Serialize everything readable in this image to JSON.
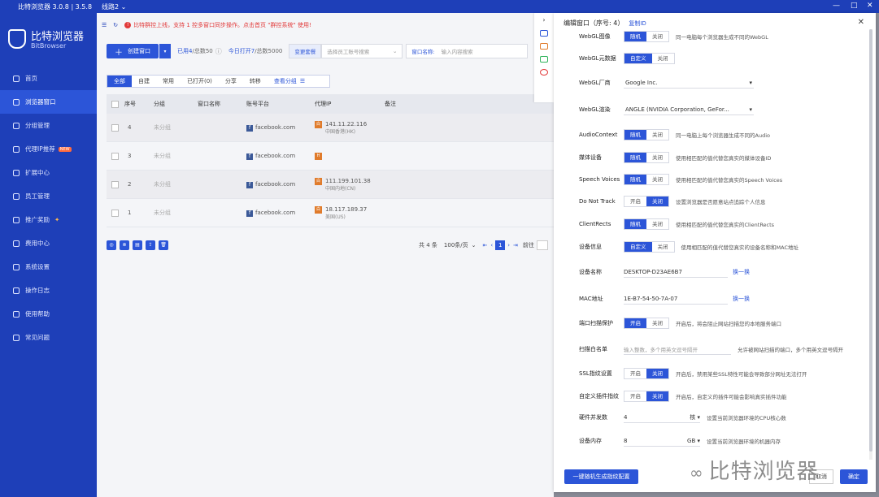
{
  "titlebar": {
    "title": "比特浏览器 3.0.8 | 3.5.8",
    "route": "线路2 ⌄"
  },
  "logo": {
    "name": "比特浏览器",
    "sub": "BitBrowser"
  },
  "sidebar": {
    "items": [
      {
        "label": "首页"
      },
      {
        "label": "浏览器窗口"
      },
      {
        "label": "分组管理"
      },
      {
        "label": "代理IP推荐",
        "badge": "NEW"
      },
      {
        "label": "扩展中心"
      },
      {
        "label": "员工管理"
      },
      {
        "label": "推广奖励"
      },
      {
        "label": "费用中心"
      },
      {
        "label": "系统设置"
      },
      {
        "label": "操作日志"
      },
      {
        "label": "使用帮助"
      },
      {
        "label": "常见问题"
      }
    ]
  },
  "notice": {
    "text": "比特群控上线，支持 1 控多窗口同步操作。点击首页 \"群控系统\" 使用!"
  },
  "toolbar": {
    "create": "创建窗口",
    "opened": "已用4",
    "total": "/总数50",
    "today": "今日打开7",
    "today_total": "/总数5000",
    "change_pkg": "变更套餐",
    "employee_placeholder": "选择员工账号搜索",
    "name_label": "窗口名称:",
    "name_placeholder": "输入内容搜索"
  },
  "tabs": {
    "items": [
      "全部",
      "自建",
      "常用",
      "已打开(0)",
      "分享",
      "转移"
    ],
    "group": "查看分组"
  },
  "table": {
    "headers": [
      "序号",
      "分组",
      "窗口名称",
      "账号平台",
      "代理IP",
      "备注"
    ],
    "rows": [
      {
        "idx": "4",
        "group": "未分组",
        "platform": "facebook.com",
        "ip": "141.11.22.116",
        "loc": "中国香港(HK)",
        "flag": "白"
      },
      {
        "idx": "3",
        "group": "未分组",
        "platform": "facebook.com",
        "ip": "",
        "loc": "",
        "flag": "H"
      },
      {
        "idx": "2",
        "group": "未分组",
        "platform": "facebook.com",
        "ip": "111.199.101.38",
        "loc": "中国内地(CN)",
        "flag": "白"
      },
      {
        "idx": "1",
        "group": "未分组",
        "platform": "facebook.com",
        "ip": "18.117.189.37",
        "loc": "美国(US)",
        "flag": "白"
      }
    ]
  },
  "pager": {
    "total": "共 4 条",
    "per": "100条/页",
    "page": "1",
    "goto": "前往"
  },
  "drawer": {
    "title": "编辑窗口（序号: 4）",
    "copy_id": "复制ID",
    "rows": {
      "webgl_image": {
        "label": "WebGL图像",
        "on": "随机",
        "off": "关闭",
        "desc": "同一电脑每个浏览器生成不同的WebGL"
      },
      "webgl_meta": {
        "label": "WebGL元数据",
        "on": "自定义",
        "off": "关闭"
      },
      "webgl_vendor": {
        "label": "WebGL厂商",
        "value": "Google Inc."
      },
      "webgl_render": {
        "label": "WebGL渲染",
        "value": "ANGLE (NVIDIA Corporation, GeFor..."
      },
      "audio": {
        "label": "AudioContext",
        "on": "随机",
        "off": "关闭",
        "desc": "同一电脑上每个浏览器生成不同的Audio"
      },
      "media": {
        "label": "媒体设备",
        "on": "随机",
        "off": "关闭",
        "desc": "使用相匹配的值代替您真实的媒体设备ID"
      },
      "speech": {
        "label": "Speech Voices",
        "on": "随机",
        "off": "关闭",
        "desc": "使用相匹配的值代替您真实的Speech Voices"
      },
      "dnt": {
        "label": "Do Not Track",
        "on": "开启",
        "off": "关闭",
        "desc": "设置浏览器是否愿意站点追踪个人信息"
      },
      "rects": {
        "label": "ClientRects",
        "on": "随机",
        "off": "关闭",
        "desc": "使用相匹配的值代替您真实的ClientRects"
      },
      "device": {
        "label": "设备信息",
        "on": "自定义",
        "off": "关闭",
        "desc": "使用相匹配的值代替您真实的设备名称和MAC地址"
      },
      "device_name": {
        "label": "设备名称",
        "value": "DESKTOP-D23AE6B7",
        "link": "换一换"
      },
      "mac": {
        "label": "MAC地址",
        "value": "1E-B7-54-50-7A-07",
        "link": "换一换"
      },
      "port": {
        "label": "端口扫描保护",
        "on": "开启",
        "off": "关闭",
        "desc": "开启后，将会阻止网站扫描您的本地服务端口"
      },
      "whitelist": {
        "label": "扫描白名单",
        "placeholder": "输入整数，多个用英文逗号隔开",
        "desc": "允许被网站扫描的端口，多个用英文逗号隔开"
      },
      "ssl": {
        "label": "SSL指纹设置",
        "on": "开启",
        "off": "关闭",
        "desc": "开启后，禁用某些SSL特性可能会导致部分网址无法打开"
      },
      "plugin": {
        "label": "自定义插件指纹",
        "on": "开启",
        "off": "关闭",
        "desc": "开启后，自定义的插件可能会影响真实插件功能"
      },
      "cpu": {
        "label": "硬件并发数",
        "value": "4",
        "unit": "核",
        "desc": "设置当前浏览器环境的CPU核心数"
      },
      "mem": {
        "label": "设备内存",
        "value": "8",
        "unit": "GB",
        "desc": "设置当前浏览器环境的机器内存"
      }
    },
    "random_btn": "一键随机生成指纹配置",
    "cancel": "取消",
    "ok": "确定"
  },
  "watermark": {
    "text": "比特浏览器"
  }
}
